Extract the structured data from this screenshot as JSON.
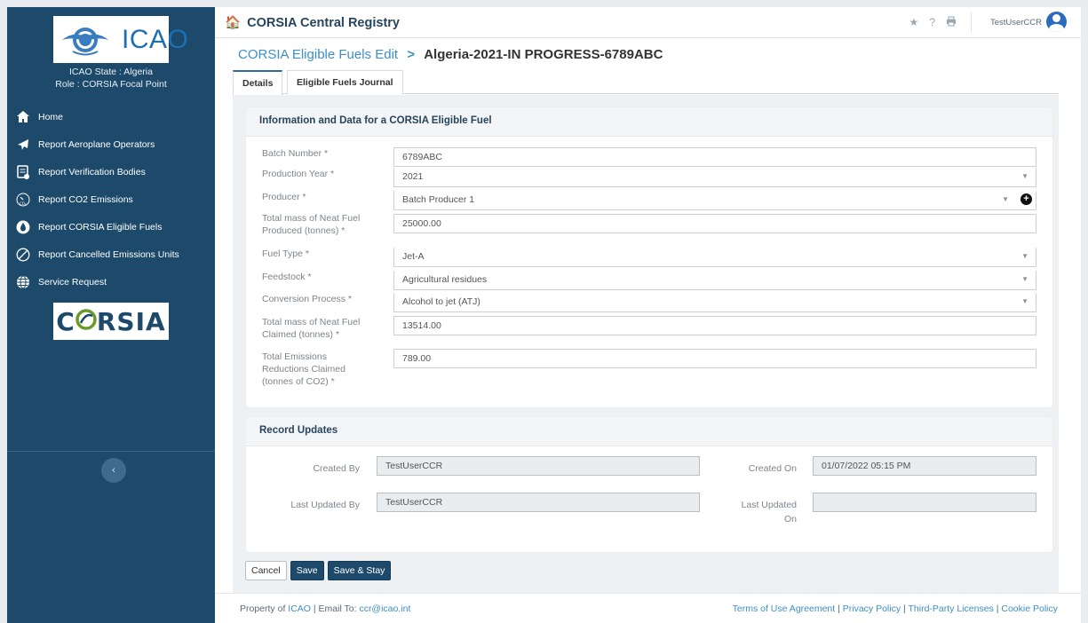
{
  "sidebar": {
    "logo_text": "ICAO",
    "state_line": "ICAO State : Algeria",
    "role_line": "Role : CORSIA Focal Point",
    "items": [
      {
        "label": "Home",
        "icon": "home-icon"
      },
      {
        "label": "Report Aeroplane Operators",
        "icon": "plane-icon"
      },
      {
        "label": "Report Verification Bodies",
        "icon": "document-icon"
      },
      {
        "label": "Report CO2 Emissions",
        "icon": "gauge-icon"
      },
      {
        "label": "Report CORSIA Eligible Fuels",
        "icon": "fuel-drop-icon"
      },
      {
        "label": "Report Cancelled Emissions Units",
        "icon": "cancel-circle-icon"
      },
      {
        "label": "Service Request",
        "icon": "globe-icon"
      }
    ],
    "corsia_logo_a": "C",
    "corsia_logo_b": "RSIA",
    "collapse_glyph": "‹"
  },
  "topbar": {
    "title": "CORSIA Central Registry",
    "user": "TestUserCCR"
  },
  "breadcrumb": {
    "parent": "CORSIA Eligible Fuels Edit",
    "separator": ">",
    "current": "Algeria-2021-IN PROGRESS-6789ABC"
  },
  "tabs": [
    "Details",
    "Eligible Fuels Journal"
  ],
  "info_section": {
    "title": "Information and Data for a CORSIA Eligible Fuel",
    "fields": [
      {
        "label": "Batch Number *",
        "value": "6789ABC"
      },
      {
        "label": "Production Year *",
        "value": "2021"
      },
      {
        "label": "Producer *",
        "value": "Batch Producer 1"
      },
      {
        "label": "Total mass of Neat Fuel Produced (tonnes) *",
        "value": "25000.00"
      },
      {
        "label": "Fuel Type *",
        "value": "Jet-A"
      },
      {
        "label": "Feedstock *",
        "value": "Agricultural residues"
      },
      {
        "label": "Conversion Process *",
        "value": "Alcohol to jet (ATJ)"
      },
      {
        "label": "Total mass of Neat Fuel Claimed (tonnes) *",
        "value": "13514.00"
      },
      {
        "label": "Total Emissions Reductions Claimed (tonnes of CO2) *",
        "value": "789.00"
      }
    ]
  },
  "record_section": {
    "title": "Record Updates",
    "created_by_label": "Created By",
    "created_by": "TestUserCCR",
    "created_on_label": "Created On",
    "created_on": "01/07/2022 05:15 PM",
    "updated_by_label": "Last Updated By",
    "updated_by": "TestUserCCR",
    "updated_on_label": "Last Updated On",
    "updated_on": ""
  },
  "buttons": {
    "cancel": "Cancel",
    "save": "Save",
    "save_stay": "Save & Stay"
  },
  "footer": {
    "property_prefix": "Property of",
    "icao_link": "ICAO",
    "email_prefix": "| Email To:",
    "email": "ccr@icao.int",
    "terms": "Terms of Use Agreement",
    "privacy": "Privacy Policy",
    "licenses": "Third-Party Licenses",
    "cookie": "Cookie Policy",
    "sep": "|"
  }
}
